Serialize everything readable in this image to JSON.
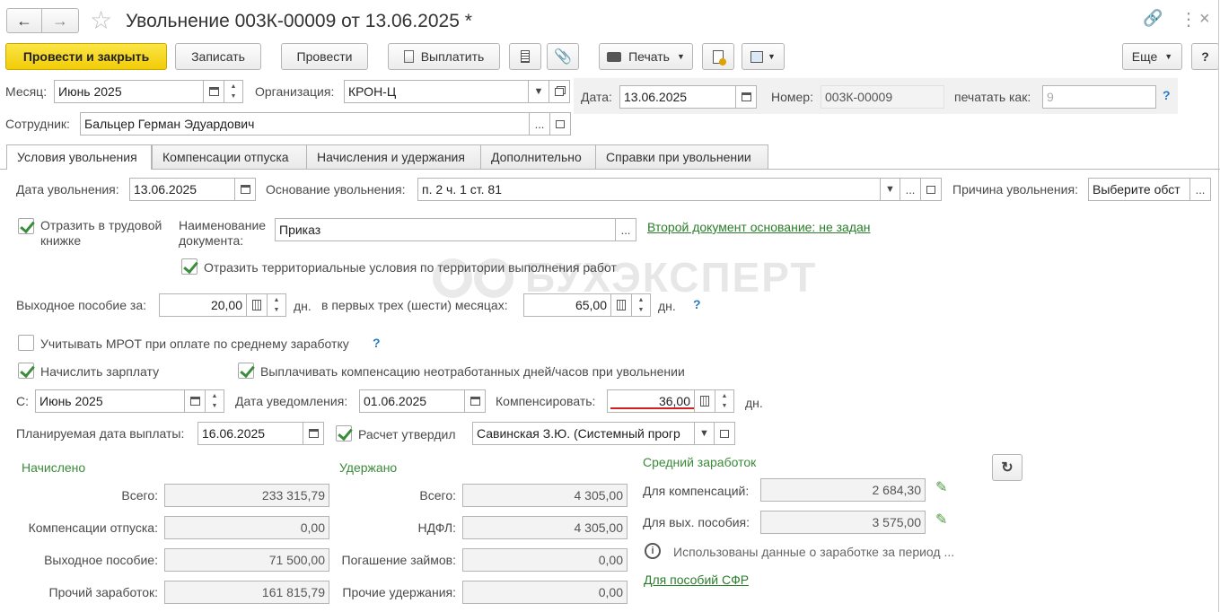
{
  "title": "Увольнение 003К-00009 от 13.06.2025 *",
  "toolbar": {
    "post_close": "Провести и закрыть",
    "save": "Записать",
    "post": "Провести",
    "pay": "Выплатить",
    "print": "Печать",
    "more": "Еще",
    "help": "?"
  },
  "header": {
    "month_label": "Месяц:",
    "month": "Июнь 2025",
    "org_label": "Организация:",
    "org": "КРОН-Ц",
    "date_label": "Дата:",
    "date": "13.06.2025",
    "number_label": "Номер:",
    "number": "003К-00009",
    "print_as_label": "печатать как:",
    "print_as": "9",
    "employee_label": "Сотрудник:",
    "employee": "Бальцер Герман Эдуардович"
  },
  "tabs": [
    "Условия увольнения",
    "Компенсации отпуска",
    "Начисления и удержания",
    "Дополнительно",
    "Справки при увольнении"
  ],
  "conditions": {
    "dismiss_date_label": "Дата увольнения:",
    "dismiss_date": "13.06.2025",
    "basis_label": "Основание увольнения:",
    "basis": "п. 2 ч. 1 ст. 81",
    "reason_label": "Причина увольнения:",
    "reason": "Выберите обст",
    "workbook_label": "Отразить в трудовой книжке",
    "docname_label": "Наименование документа:",
    "docname": "Приказ",
    "second_doc_link": "Второй документ основание: не задан",
    "territorial_label": "Отразить территориальные условия по территории выполнения работ",
    "watermark": "БУХЭКСПЕРТ",
    "severance_label": "Выходное пособие за:",
    "severance_days": "20,00",
    "days_unit": "дн.",
    "first_months_label": "в первых трех (шести) месяцах:",
    "first_months_days": "65,00",
    "mrot_label": "Учитывать МРОТ при оплате по среднему заработку",
    "accrue_salary_label": "Начислить зарплату",
    "pay_comp_label": "Выплачивать компенсацию неотработанных дней/часов при увольнении",
    "from_label": "С:",
    "from_month": "Июнь 2025",
    "notice_label": "Дата уведомления:",
    "notice_date": "01.06.2025",
    "compensate_label": "Компенсировать:",
    "compensate_days": "36,00",
    "planned_label": "Планируемая дата выплаты:",
    "planned_date": "16.06.2025",
    "approved_label": "Расчет утвердил",
    "approved_by": "Савинская З.Ю. (Системный прогр"
  },
  "accrued": {
    "title": "Начислено",
    "rows": [
      {
        "label": "Всего:",
        "value": "233 315,79"
      },
      {
        "label": "Компенсации отпуска:",
        "value": "0,00"
      },
      {
        "label": "Выходное пособие:",
        "value": "71 500,00"
      },
      {
        "label": "Прочий заработок:",
        "value": "161 815,79"
      }
    ]
  },
  "withheld": {
    "title": "Удержано",
    "rows": [
      {
        "label": "Всего:",
        "value": "4 305,00"
      },
      {
        "label": "НДФЛ:",
        "value": "4 305,00"
      },
      {
        "label": "Погашение займов:",
        "value": "0,00"
      },
      {
        "label": "Прочие удержания:",
        "value": "0,00"
      }
    ]
  },
  "average": {
    "title": "Средний заработок",
    "comp_label": "Для компенсаций:",
    "comp": "2 684,30",
    "sev_label": "Для вых. пособия:",
    "sev": "3 575,00",
    "info": "Использованы данные о заработке за период ...",
    "sfr_link": "Для пособий СФР"
  }
}
